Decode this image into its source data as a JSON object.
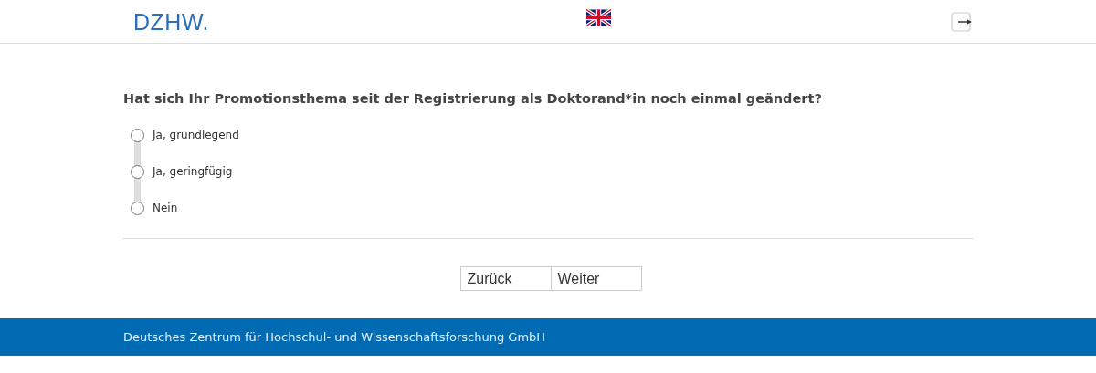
{
  "header": {
    "logo": "DZHW."
  },
  "question": {
    "text": "Hat sich Ihr Promotionsthema seit der Registrierung als Doktorand*in noch einmal geändert?",
    "options": [
      {
        "label": "Ja, grundlegend",
        "selected": false
      },
      {
        "label": "Ja, geringfügig",
        "selected": false
      },
      {
        "label": "Nein",
        "selected": false
      }
    ]
  },
  "buttons": [
    "Zurück",
    "Weiter"
  ],
  "footer": {
    "text": "Deutsches Zentrum für Hochschul- und Wissenschaftsforschung GmbH"
  }
}
